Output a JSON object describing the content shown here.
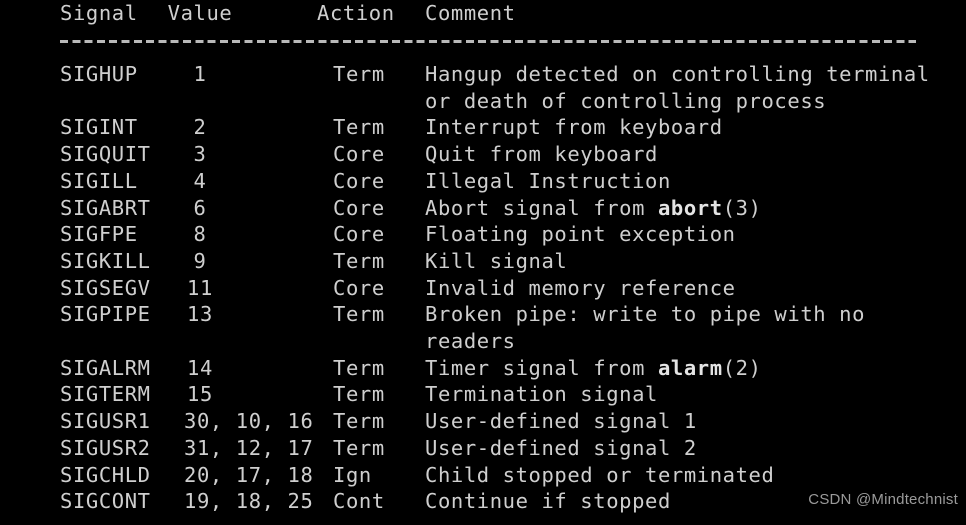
{
  "terminal": {
    "background_color": "#000000",
    "text_color": "#cfcfcf"
  },
  "table": {
    "headers": {
      "signal": "Signal",
      "value": "Value",
      "action": "Action",
      "comment": "Comment"
    },
    "separator": "----------------------------------------------------------------",
    "rows": [
      {
        "signal": "SIGHUP",
        "value": "1",
        "action": "Term",
        "comment": "Hangup detected on controlling terminal",
        "comment_cont": "or death of controlling process",
        "bold_token": "",
        "comment_tail": ""
      },
      {
        "signal": "SIGINT",
        "value": "2",
        "action": "Term",
        "comment": "Interrupt from keyboard",
        "comment_cont": "",
        "bold_token": "",
        "comment_tail": ""
      },
      {
        "signal": "SIGQUIT",
        "value": "3",
        "action": "Core",
        "comment": "Quit from keyboard",
        "comment_cont": "",
        "bold_token": "",
        "comment_tail": ""
      },
      {
        "signal": "SIGILL",
        "value": "4",
        "action": "Core",
        "comment": "Illegal Instruction",
        "comment_cont": "",
        "bold_token": "",
        "comment_tail": ""
      },
      {
        "signal": "SIGABRT",
        "value": "6",
        "action": "Core",
        "comment": "Abort signal from ",
        "comment_cont": "",
        "bold_token": "abort",
        "comment_tail": "(3)"
      },
      {
        "signal": "SIGFPE",
        "value": "8",
        "action": "Core",
        "comment": "Floating point exception",
        "comment_cont": "",
        "bold_token": "",
        "comment_tail": ""
      },
      {
        "signal": "SIGKILL",
        "value": "9",
        "action": "Term",
        "comment": "Kill signal",
        "comment_cont": "",
        "bold_token": "",
        "comment_tail": ""
      },
      {
        "signal": "SIGSEGV",
        "value": "11",
        "action": "Core",
        "comment": "Invalid memory reference",
        "comment_cont": "",
        "bold_token": "",
        "comment_tail": ""
      },
      {
        "signal": "SIGPIPE",
        "value": "13",
        "action": "Term",
        "comment": "Broken pipe: write to pipe with no",
        "comment_cont": "readers",
        "bold_token": "",
        "comment_tail": ""
      },
      {
        "signal": "SIGALRM",
        "value": "14",
        "action": "Term",
        "comment": "Timer signal from ",
        "comment_cont": "",
        "bold_token": "alarm",
        "comment_tail": "(2)"
      },
      {
        "signal": "SIGTERM",
        "value": "15",
        "action": "Term",
        "comment": "Termination signal",
        "comment_cont": "",
        "bold_token": "",
        "comment_tail": ""
      },
      {
        "signal": "SIGUSR1",
        "value": "30, 10, 16",
        "action": "Term",
        "comment": "User-defined signal 1",
        "comment_cont": "",
        "bold_token": "",
        "comment_tail": ""
      },
      {
        "signal": "SIGUSR2",
        "value": "31, 12, 17",
        "action": "Term",
        "comment": "User-defined signal 2",
        "comment_cont": "",
        "bold_token": "",
        "comment_tail": ""
      },
      {
        "signal": "SIGCHLD",
        "value": "20, 17, 18",
        "action": "Ign",
        "comment": "Child stopped or terminated",
        "comment_cont": "",
        "bold_token": "",
        "comment_tail": ""
      },
      {
        "signal": "SIGCONT",
        "value": "19, 18, 25",
        "action": "Cont",
        "comment": "Continue if stopped",
        "comment_cont": "",
        "bold_token": "",
        "comment_tail": ""
      }
    ]
  },
  "watermark": {
    "text": "CSDN @Mindtechnist"
  }
}
